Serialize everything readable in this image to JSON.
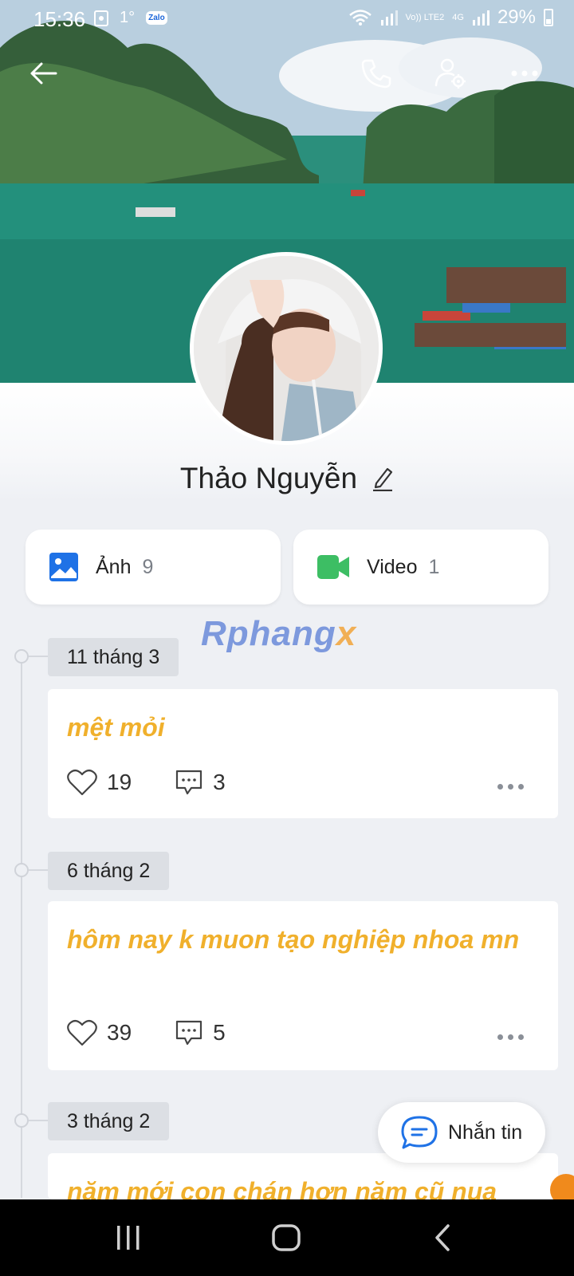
{
  "status_bar": {
    "time": "15:36",
    "temp": "1°",
    "zalo": "Zalo",
    "volte": "Vo)) LTE2",
    "net": "4G",
    "battery": "29%"
  },
  "profile": {
    "name": "Thảo Nguyễn"
  },
  "media": {
    "photos_label": "Ảnh",
    "photos_count": "9",
    "videos_label": "Video",
    "videos_count": "1"
  },
  "watermark": {
    "text": "Rphang",
    "x": "x"
  },
  "posts": [
    {
      "date": "11 tháng 3",
      "text": "mệt mỏi",
      "likes": "19",
      "comments": "3"
    },
    {
      "date": "6 tháng 2",
      "text": "hôm nay k muon tạo nghiệp nhoa mn",
      "likes": "39",
      "comments": "5"
    },
    {
      "date": "3 tháng 2",
      "text": "năm mới con chán hơn năm cũ nua"
    }
  ],
  "fab": {
    "label": "Nhắn tin"
  },
  "colors": {
    "post_text": "#f0b02c",
    "photo_icon": "#1f72e6",
    "video_icon": "#3dbe64",
    "chat_icon": "#1f72e6"
  }
}
